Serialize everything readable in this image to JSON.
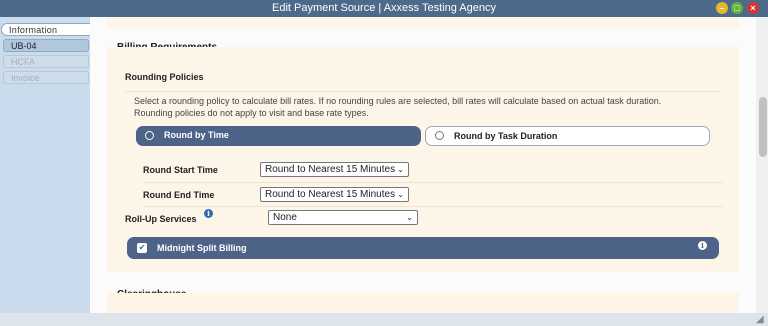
{
  "window": {
    "title": "Edit Payment Source | Axxess Testing Agency",
    "min_label": "–",
    "max_label": "□",
    "close_label": "×"
  },
  "sidebar": {
    "tabs": [
      {
        "label": "Information",
        "state": "active"
      },
      {
        "label": "UB-04",
        "state": "enabled"
      },
      {
        "label": "HCFA",
        "state": "disabled"
      },
      {
        "label": "Invoice",
        "state": "disabled"
      }
    ]
  },
  "billing": {
    "heading": "Billing Requirements",
    "rounding": {
      "heading": "Rounding Policies",
      "description_line1": "Select a rounding policy to calculate bill rates. If no rounding rules are selected, bill rates will calculate based on actual task duration.",
      "description_line2": "Rounding policies do not apply to visit and base rate types.",
      "option_time": "Round by Time",
      "option_duration": "Round by Task Duration",
      "selected": "Round by Time"
    },
    "start_time": {
      "label": "Round Start Time",
      "value": "Round to Nearest 15 Minutes"
    },
    "end_time": {
      "label": "Round End Time",
      "value": "Round to Nearest 15 Minutes"
    },
    "rollup": {
      "label": "Roll-Up Services",
      "value": "None",
      "info_icon": "info-icon"
    },
    "midnight": {
      "label": "Midnight Split Billing",
      "checked": true,
      "check_glyph": "✔",
      "info_glyph": "i"
    }
  },
  "clearinghouse": {
    "heading": "Clearinghouse"
  },
  "icons": {
    "chevron": "⌄",
    "info": "i",
    "resize": "◢"
  },
  "colors": {
    "titlebar": "#4e6a8a",
    "selected_option": "#4d6488",
    "panel": "#fdf5e7",
    "sidebar": "#c9dbed",
    "info_icon": "#2d6bb3"
  }
}
